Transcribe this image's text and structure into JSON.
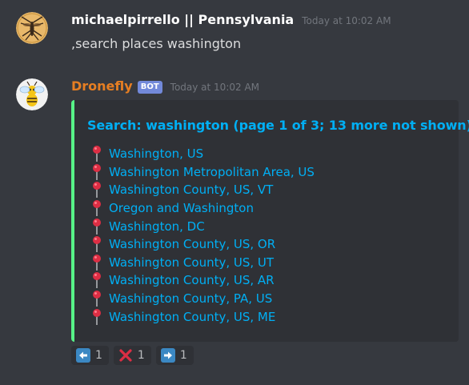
{
  "messages": [
    {
      "author": "michaelpirrello || Pennsylvania",
      "timestamp": "Today at 10:02 AM",
      "content": ",search places washington"
    },
    {
      "author": "Dronefly",
      "bot_tag": "BOT",
      "timestamp": "Today at 10:02 AM"
    }
  ],
  "embed": {
    "title": "Search: washington (page 1 of 3; 13 more not shown)",
    "accent_color": "#57f287",
    "link_color": "#00aff4",
    "pin_icon": "round-pushpin-icon",
    "results": [
      "Washington, US",
      "Washington Metropolitan Area, US",
      "Washington County, US, VT",
      "Oregon and Washington",
      "Washington, DC",
      "Washington County, US, OR",
      "Washington County, US, UT",
      "Washington County, US, AR",
      "Washington County, PA, US",
      "Washington County, US, ME"
    ]
  },
  "reactions": [
    {
      "icon": "arrow-left-icon",
      "count": "1"
    },
    {
      "icon": "cross-mark-icon",
      "count": "1"
    },
    {
      "icon": "arrow-right-icon",
      "count": "1"
    }
  ]
}
